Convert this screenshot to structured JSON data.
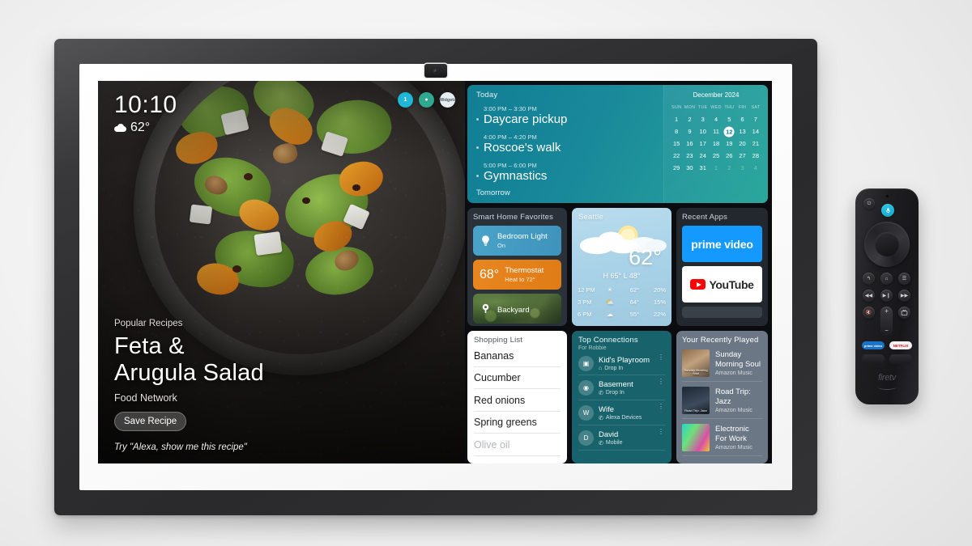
{
  "device": {
    "name": "Echo Show 15 smart display",
    "camera_icon": "camera-icon"
  },
  "screen": {
    "clock": {
      "time": "10:10",
      "temperature": "62°",
      "weather_icon": "cloud-icon"
    },
    "status_badges": [
      {
        "name": "notification-badge",
        "label": "1",
        "color": "#1fb6d8"
      },
      {
        "name": "profile-badge",
        "label": "",
        "color": "#2fa88f"
      },
      {
        "name": "widgets-badge",
        "label": "Widgets",
        "color": "#e6eef2"
      }
    ],
    "recipe": {
      "eyebrow": "Popular Recipes",
      "title_line1": "Feta &",
      "title_line2": "Arugula Salad",
      "source": "Food Network",
      "save_label": "Save Recipe",
      "alexa_tip": "Try \"Alexa, show me this recipe\""
    },
    "today": {
      "title": "Today",
      "tomorrow_label": "Tomorrow",
      "events": [
        {
          "time": "3:00 PM – 3:30 PM",
          "name": "Daycare pickup"
        },
        {
          "time": "4:00 PM – 4:20 PM",
          "name": "Roscoe's walk"
        },
        {
          "time": "5:00 PM – 6:00 PM",
          "name": "Gymnastics"
        }
      ]
    },
    "calendar": {
      "month": "December 2024",
      "dow": [
        "SUN",
        "MON",
        "TUE",
        "WED",
        "THU",
        "FRI",
        "SAT"
      ],
      "today": 12,
      "days": [
        {
          "n": "1"
        },
        {
          "n": "2"
        },
        {
          "n": "3"
        },
        {
          "n": "4"
        },
        {
          "n": "5"
        },
        {
          "n": "6"
        },
        {
          "n": "7"
        },
        {
          "n": "8"
        },
        {
          "n": "9"
        },
        {
          "n": "10"
        },
        {
          "n": "11"
        },
        {
          "n": "12",
          "today": true
        },
        {
          "n": "13"
        },
        {
          "n": "14"
        },
        {
          "n": "15"
        },
        {
          "n": "16"
        },
        {
          "n": "17"
        },
        {
          "n": "18"
        },
        {
          "n": "19"
        },
        {
          "n": "20"
        },
        {
          "n": "21"
        },
        {
          "n": "22"
        },
        {
          "n": "23"
        },
        {
          "n": "24"
        },
        {
          "n": "25"
        },
        {
          "n": "26"
        },
        {
          "n": "27"
        },
        {
          "n": "28"
        },
        {
          "n": "29"
        },
        {
          "n": "30"
        },
        {
          "n": "31"
        },
        {
          "n": "1",
          "muted": true
        },
        {
          "n": "2",
          "muted": true
        },
        {
          "n": "3",
          "muted": true
        },
        {
          "n": "4",
          "muted": true
        }
      ]
    },
    "smart_home": {
      "title": "Smart Home Favorites",
      "tiles": [
        {
          "name": "Bedroom Light",
          "sub": "On",
          "icon": "lightbulb-icon",
          "kind": "light"
        },
        {
          "name": "Thermostat",
          "sub": "Heat to 72°",
          "value": "68°",
          "icon": "thermostat-icon",
          "kind": "thermostat"
        },
        {
          "name": "Backyard",
          "sub": "",
          "icon": "camera-icon",
          "kind": "camera"
        }
      ]
    },
    "weather": {
      "city": "Seattle",
      "current": "62°",
      "high_low": "H 65° L 48°",
      "icon": "partly-cloudy-icon",
      "hourly": [
        {
          "hour": "12 PM",
          "icon": "sun-icon",
          "temp": "62°",
          "precip": "20%"
        },
        {
          "hour": "3 PM",
          "icon": "partly-cloudy-icon",
          "temp": "64°",
          "precip": "15%"
        },
        {
          "hour": "6 PM",
          "icon": "cloud-icon",
          "temp": "55°",
          "precip": "22%"
        }
      ]
    },
    "recent_apps": {
      "title": "Recent Apps",
      "apps": [
        {
          "name": "prime video",
          "kind": "prime"
        },
        {
          "name": "YouTube",
          "kind": "youtube"
        }
      ]
    },
    "shopping_list": {
      "title": "Shopping List",
      "items": [
        {
          "text": "Bananas"
        },
        {
          "text": "Cucumber"
        },
        {
          "text": "Red onions"
        },
        {
          "text": "Spring greens"
        },
        {
          "text": "Olive oil",
          "faded": true
        }
      ]
    },
    "connections": {
      "title": "Top Connections",
      "subtitle": "For Robbie",
      "rows": [
        {
          "name": "Kid's Playroom",
          "meta": "Drop In",
          "icon": "device-icon",
          "meta_icon": "drop-in-icon",
          "initial": ""
        },
        {
          "name": "Basement",
          "meta": "Drop In",
          "icon": "echo-icon",
          "meta_icon": "phone-icon",
          "initial": ""
        },
        {
          "name": "Wife",
          "meta": "Alexa Devices",
          "icon": "avatar-icon",
          "meta_icon": "phone-icon",
          "initial": "W"
        },
        {
          "name": "David",
          "meta": "Mobile",
          "icon": "avatar-icon",
          "meta_icon": "phone-icon",
          "initial": "D"
        }
      ]
    },
    "recently_played": {
      "title": "Your Recently Played",
      "tracks": [
        {
          "title_line1": "Sunday",
          "title_line2": "Morning Soul",
          "source": "Amazon Music",
          "art_caption": "Sunday Morning Soul"
        },
        {
          "title_line1": "Road Trip: Jazz",
          "title_line2": "",
          "source": "Amazon Music",
          "art_caption": "Road Trip: Jazz"
        },
        {
          "title_line1": "Electronic",
          "title_line2": "For Work",
          "source": "Amazon Music",
          "art_caption": ""
        }
      ]
    }
  },
  "remote": {
    "name": "Fire TV Alexa Voice Remote",
    "brand": "firetv",
    "buttons": [
      {
        "name": "power-button",
        "glyph": "⏻"
      },
      {
        "name": "voice-button",
        "glyph": "🎤"
      },
      {
        "name": "back-button",
        "glyph": "↰"
      },
      {
        "name": "home-button",
        "glyph": "⌂"
      },
      {
        "name": "menu-button",
        "glyph": "☰"
      },
      {
        "name": "rewind-button",
        "glyph": "◀◀"
      },
      {
        "name": "play-pause-button",
        "glyph": "▶❙❙"
      },
      {
        "name": "fast-forward-button",
        "glyph": "▶▶"
      },
      {
        "name": "mute-button",
        "glyph": "🔇"
      },
      {
        "name": "tv-button",
        "glyph": "📺"
      },
      {
        "name": "volume-up",
        "glyph": "+"
      },
      {
        "name": "volume-down",
        "glyph": "−"
      }
    ],
    "app_buttons": [
      {
        "name": "prime-video-button",
        "label": "prime video"
      },
      {
        "name": "netflix-button",
        "label": "NETFLIX"
      }
    ]
  },
  "colors": {
    "accent_teal": "#18889a",
    "accent_orange": "#e8861f",
    "accent_blue": "#1399ff",
    "netflix_red": "#e50914"
  }
}
